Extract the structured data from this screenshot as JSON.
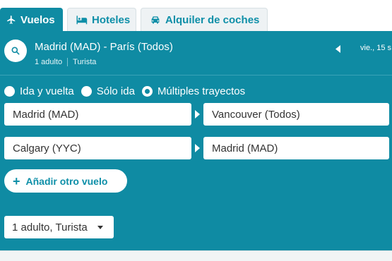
{
  "tabs": {
    "flights": {
      "label": "Vuelos",
      "icon": "airplane-icon",
      "active": true
    },
    "hotels": {
      "label": "Hoteles",
      "icon": "bed-icon",
      "active": false
    },
    "cars": {
      "label": "Alquiler de coches",
      "icon": "car-icon",
      "active": false
    }
  },
  "summary": {
    "route": "Madrid (MAD) - París (Todos)",
    "passengers": "1 adulto",
    "cabin": "Turista",
    "date": "vie., 15 s"
  },
  "trip_types": [
    {
      "label": "Ida y vuelta",
      "checked": false
    },
    {
      "label": "Sólo ida",
      "checked": false
    },
    {
      "label": "Múltiples trayectos",
      "checked": true
    }
  ],
  "legs": [
    {
      "from": "Madrid (MAD)",
      "to": "Vancouver (Todos)"
    },
    {
      "from": "Calgary (YYC)",
      "to": "Madrid (MAD)"
    }
  ],
  "add_flight_label": "Añadir otro vuelo",
  "passengers_select": "1 adulto, Turista",
  "colors": {
    "primary": "#0f8ba3",
    "tab_text": "#0e8fa8",
    "white": "#ffffff"
  }
}
